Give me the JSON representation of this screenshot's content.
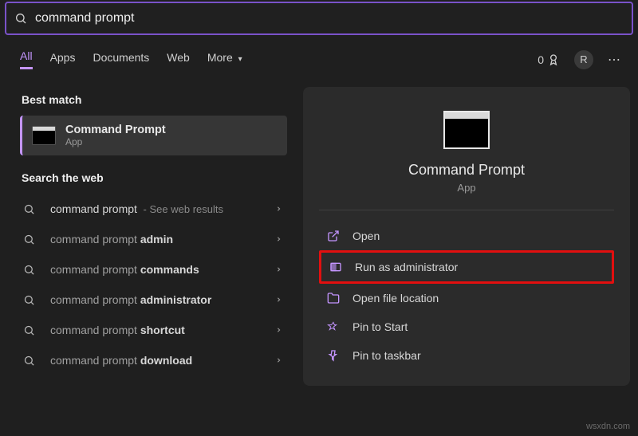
{
  "search": {
    "value": "command prompt"
  },
  "tabs": {
    "all": "All",
    "apps": "Apps",
    "documents": "Documents",
    "web": "Web",
    "more": "More"
  },
  "rewards": "0",
  "avatar_letter": "R",
  "left": {
    "best_match_head": "Best match",
    "best_match": {
      "title": "Command Prompt",
      "sub": "App"
    },
    "search_web_head": "Search the web",
    "items": [
      {
        "pre": "",
        "main": "command prompt",
        "hint": " - See web results"
      },
      {
        "pre": "command prompt ",
        "bold": "admin"
      },
      {
        "pre": "command prompt ",
        "bold": "commands"
      },
      {
        "pre": "command prompt ",
        "bold": "administrator"
      },
      {
        "pre": "command prompt ",
        "bold": "shortcut"
      },
      {
        "pre": "command prompt ",
        "bold": "download"
      }
    ]
  },
  "right": {
    "title": "Command Prompt",
    "sub": "App",
    "actions": {
      "open": "Open",
      "run_admin": "Run as administrator",
      "open_loc": "Open file location",
      "pin_start": "Pin to Start",
      "pin_taskbar": "Pin to taskbar"
    }
  },
  "watermark": "wsxdn.com"
}
